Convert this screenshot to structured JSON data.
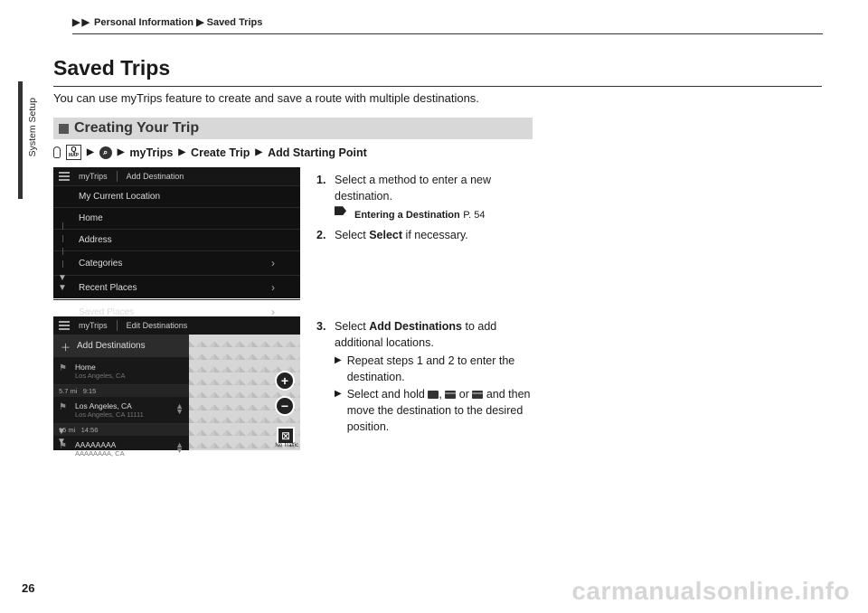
{
  "breadcrumb": {
    "a": "Personal Information",
    "b": "Saved Trips"
  },
  "side_tab": "System Setup",
  "page_title": "Saved Trips",
  "intro": "You can use myTrips feature to create and save a route with multiple destinations.",
  "section_heading": "Creating Your Trip",
  "nav": {
    "map_q": "Q",
    "map_text": "MAP",
    "a": "myTrips",
    "b": "Create Trip",
    "c": "Add Starting Point"
  },
  "fig1": {
    "hdr_a": "myTrips",
    "hdr_b": "Add Destination",
    "rows": [
      "My Current Location",
      "Home",
      "Address",
      "Categories",
      "Recent Places",
      "Saved Places"
    ]
  },
  "fig2": {
    "hdr_a": "myTrips",
    "hdr_b": "Edit Destinations",
    "add": "Add Destinations",
    "e1_t": "Home",
    "e1_s": "Los Angeles, CA",
    "d1": "5.7 mi",
    "t1": "9:15",
    "e2_t": "Los Angeles, CA",
    "e2_s": "Los Angeles, CA 11111",
    "d2": "15 mi",
    "t2": "14:56",
    "e3_t": "AAAAAAAA",
    "e3_s": "AAAAAAAA, CA",
    "map_btm": "No Traffic"
  },
  "steps": {
    "s1": "Select a method to enter a new destination.",
    "xref": "Entering a Destination",
    "xref_page": "P. 54",
    "s2a": "Select ",
    "s2b": "Select",
    "s2c": " if necessary.",
    "s3a": "Select ",
    "s3b": "Add Destinations",
    "s3c": " to add additional locations.",
    "s3_sub1": "Repeat steps 1 and 2 to enter the destination.",
    "s3_sub2a": "Select and hold ",
    "s3_sub2b": ", ",
    "s3_sub2c": " or ",
    "s3_sub2d": " and then move the destination to the desired position."
  },
  "page_num": "26",
  "watermark": "carmanualsonline.info"
}
